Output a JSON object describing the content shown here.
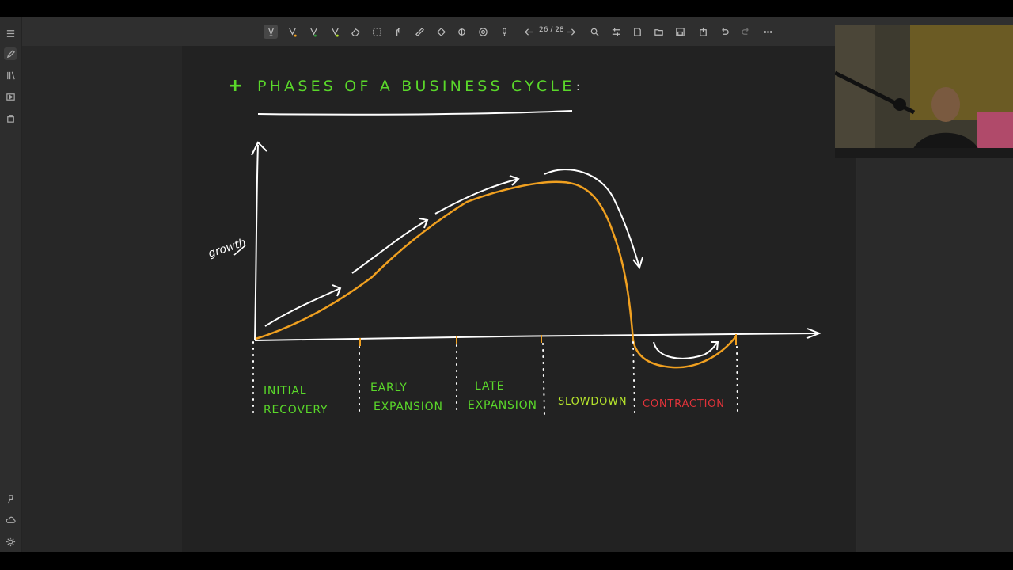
{
  "toolbar": {
    "page_indicator": "26 / 28",
    "tools": [
      "lasso-pen-icon",
      "pen-orange-icon",
      "pen-green-icon",
      "pen-yellow-icon",
      "eraser-icon",
      "selection-icon",
      "hand-icon",
      "ruler-icon",
      "shapes-icon",
      "touch-icon",
      "stamp-icon",
      "mic-icon"
    ]
  },
  "leftbar": {
    "items": [
      "menu-icon",
      "pencil-icon",
      "library-icon",
      "media-icon",
      "bag-icon",
      "pin-icon",
      "cloud-icon",
      "settings-icon"
    ]
  },
  "slide": {
    "title_prefix": "+",
    "title": "PHASES OF A BUSINESS CYCLE",
    "title_suffix": ":",
    "y_axis_label": "growth",
    "phases": [
      {
        "line1": "INITIAL",
        "line2": "RECOVERY",
        "color": "#5ad82a"
      },
      {
        "line1": "EARLY",
        "line2": "EXPANSION",
        "color": "#5ad82a"
      },
      {
        "line1": "LATE",
        "line2": "EXPANSION",
        "color": "#5ad82a"
      },
      {
        "line1": "SLOWDOWN",
        "line2": "",
        "color": "#b7e62c"
      },
      {
        "line1": "CONTRACTION",
        "line2": "",
        "color": "#e0333a"
      }
    ]
  },
  "colors": {
    "curve": "#f0a020",
    "ink": "#ffffff",
    "title_green": "#5ad82a"
  }
}
